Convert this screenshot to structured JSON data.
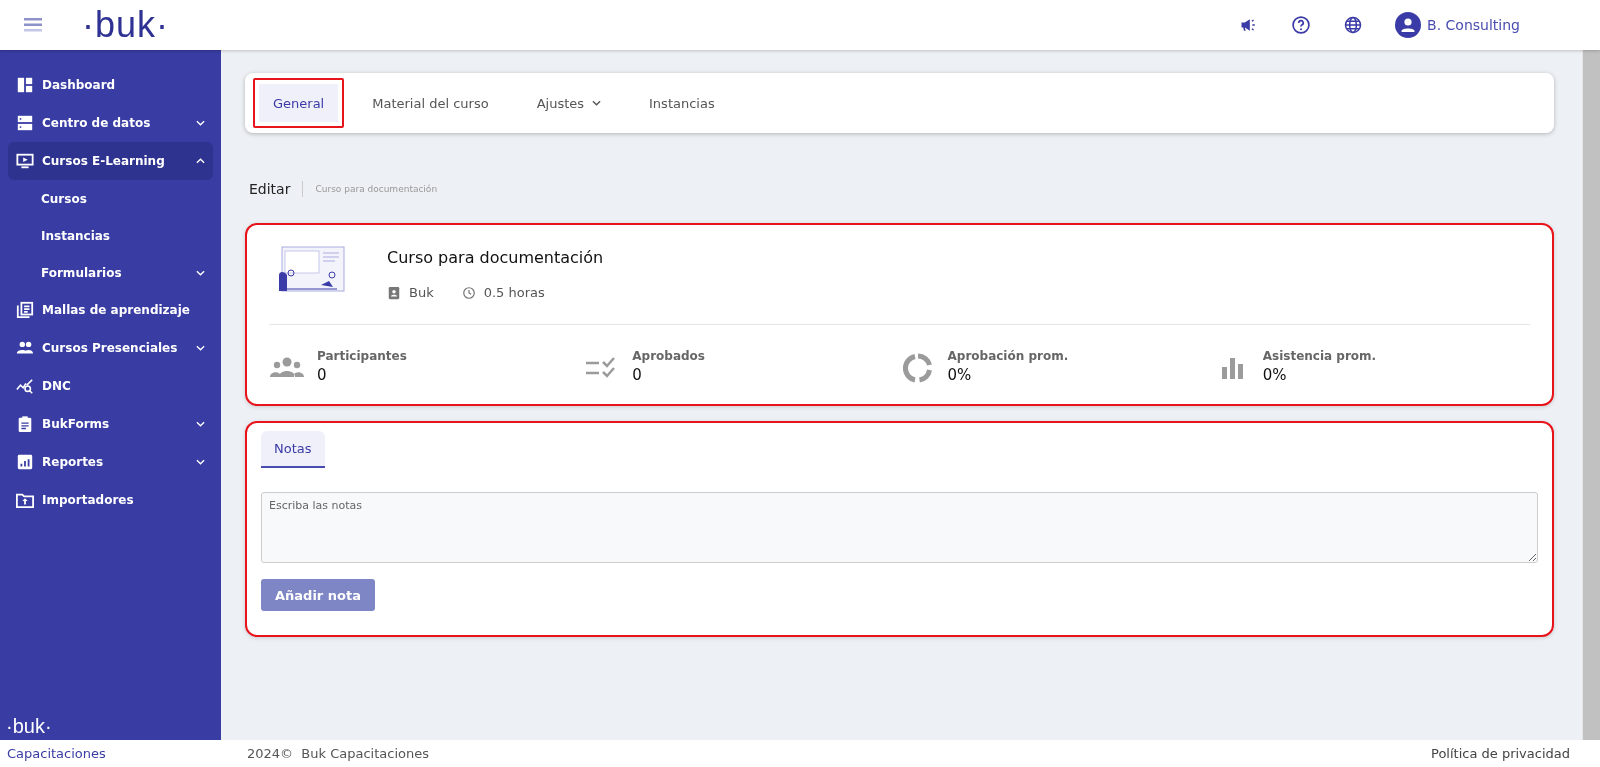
{
  "header": {
    "logo": "·buk·",
    "user": "B. Consulting"
  },
  "sidebar": {
    "items": [
      {
        "label": "Dashboard",
        "kind": "link",
        "selected": false
      },
      {
        "label": "Centro de datos",
        "kind": "group",
        "expanded": false,
        "selected": false
      },
      {
        "label": "Cursos E-Learning",
        "kind": "group",
        "expanded": true,
        "selected": true,
        "children": [
          {
            "label": "Cursos",
            "kind": "link"
          },
          {
            "label": "Instancias",
            "kind": "link"
          },
          {
            "label": "Formularios",
            "kind": "group",
            "expanded": false
          }
        ]
      },
      {
        "label": "Mallas de aprendizaje",
        "kind": "link",
        "selected": false
      },
      {
        "label": "Cursos Presenciales",
        "kind": "group",
        "expanded": false,
        "selected": false
      },
      {
        "label": "DNC",
        "kind": "link",
        "selected": false
      },
      {
        "label": "BukForms",
        "kind": "group",
        "expanded": false,
        "selected": false
      },
      {
        "label": "Reportes",
        "kind": "group",
        "expanded": false,
        "selected": false
      },
      {
        "label": "Importadores",
        "kind": "link",
        "selected": false
      }
    ],
    "footer_logo": "·buk·",
    "footer_label": "Capacitaciones"
  },
  "tabs": [
    {
      "label": "General",
      "selected": true,
      "highlighted": true,
      "kind": "tab"
    },
    {
      "label": "Material del curso",
      "selected": false,
      "highlighted": false,
      "kind": "tab"
    },
    {
      "label": "Ajustes",
      "selected": false,
      "highlighted": false,
      "kind": "dropdown"
    },
    {
      "label": "Instancias",
      "selected": false,
      "highlighted": false,
      "kind": "tab"
    }
  ],
  "breadcrumb": {
    "title": "Editar",
    "subtitle": "Curso para documentación"
  },
  "course_card": {
    "highlighted": true,
    "title": "Curso para documentación",
    "owner": "Buk",
    "duration": "0.5 horas",
    "stats": [
      {
        "label": "Participantes",
        "value": "0"
      },
      {
        "label": "Aprobados",
        "value": "0"
      },
      {
        "label": "Aprobación prom.",
        "value": "0%"
      },
      {
        "label": "Asistencia prom.",
        "value": "0%"
      }
    ]
  },
  "notes_card": {
    "highlighted": true,
    "tabs": [
      {
        "label": "Notas",
        "selected": true
      }
    ],
    "placeholder": "Escriba las notas",
    "button": "Añadir nota"
  },
  "footer": {
    "copyright": "2024©  Buk Capacitaciones",
    "privacy": "Política de privacidad"
  }
}
